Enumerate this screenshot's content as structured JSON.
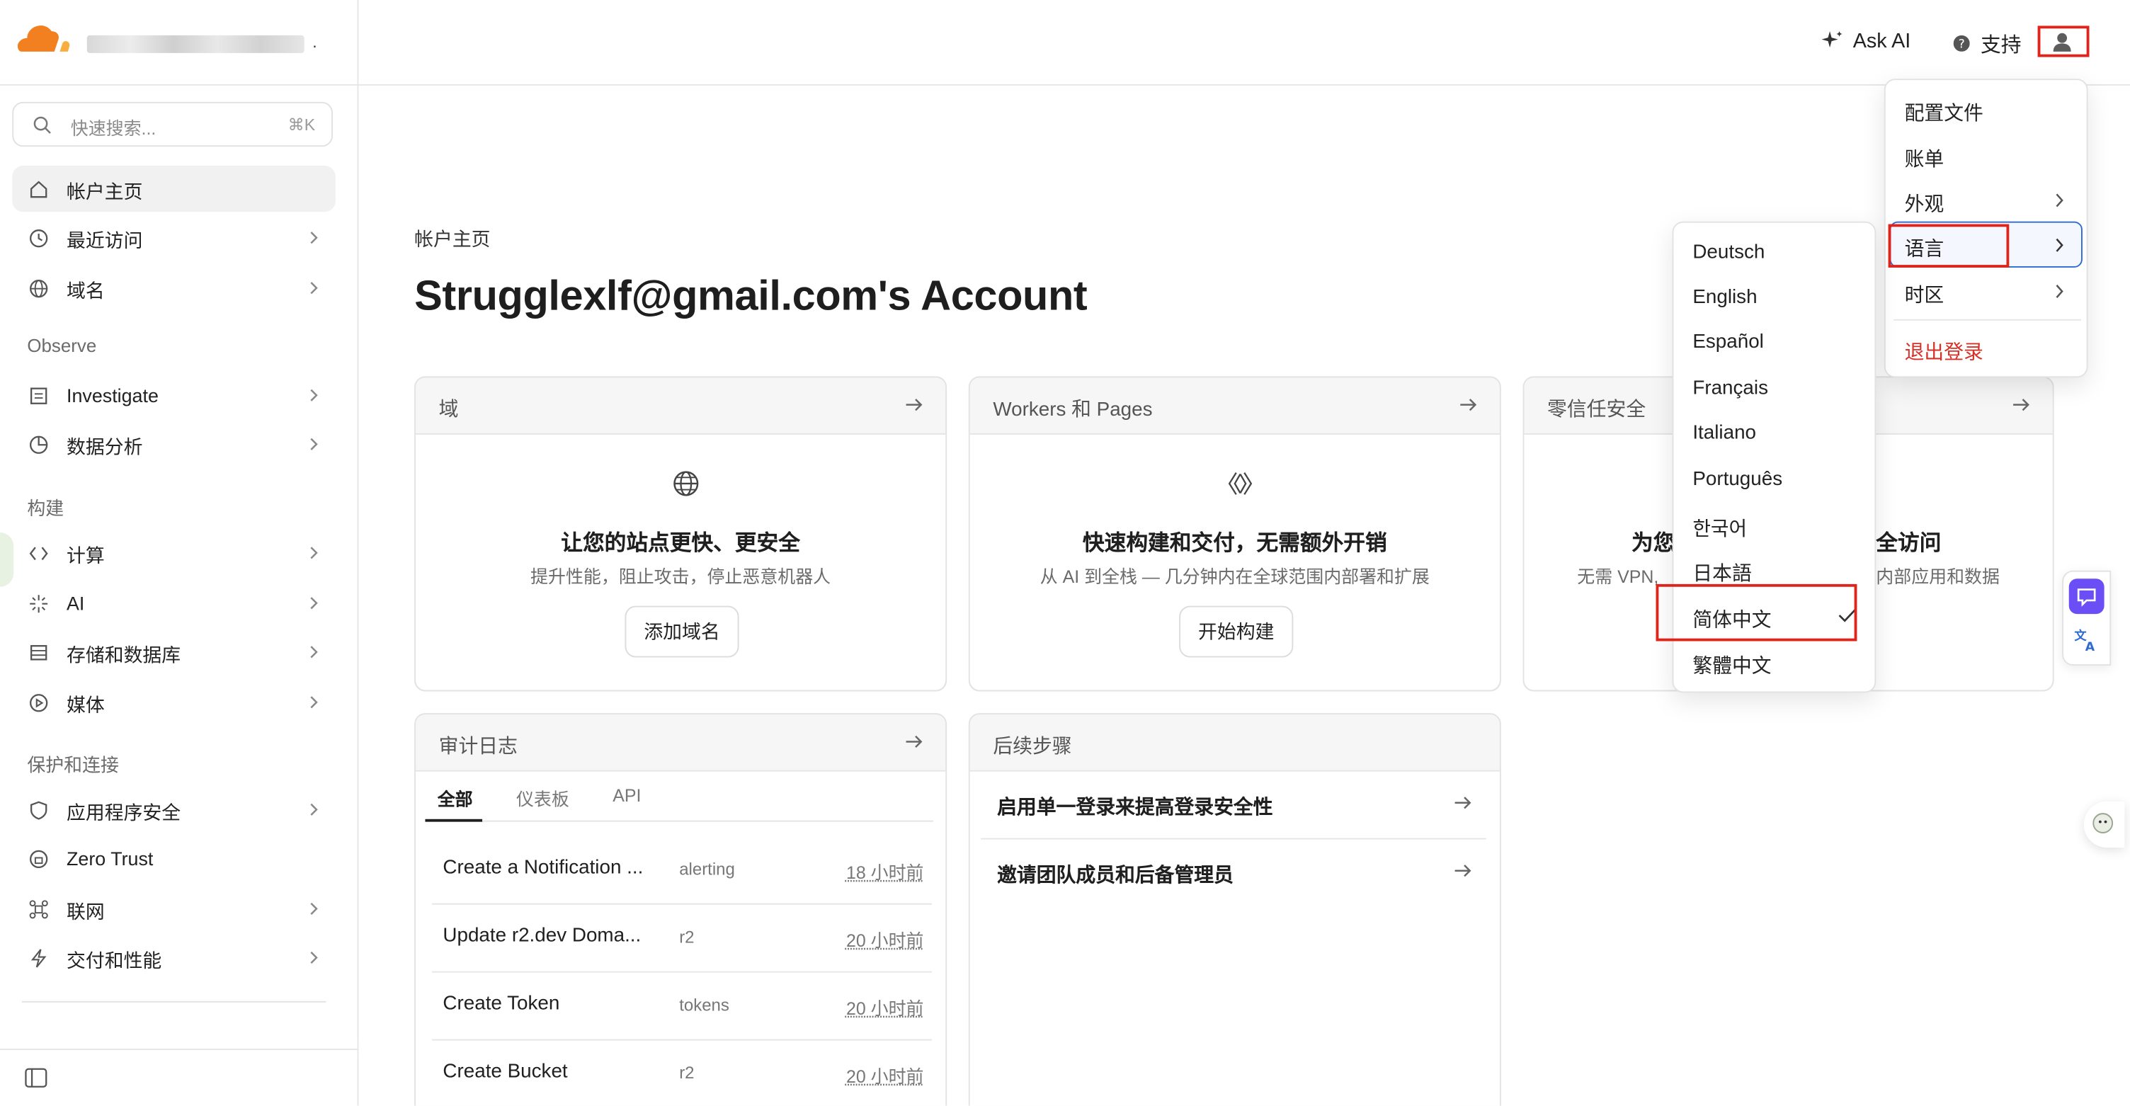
{
  "colors": {
    "accent": "#f38020",
    "danger": "#d63027",
    "highlight": "#e0241b",
    "selection_blue": "#2d6bd4"
  },
  "header": {
    "ask_ai": "Ask AI",
    "support": "支持"
  },
  "search": {
    "placeholder": "快速搜索...",
    "shortcut": "⌘K"
  },
  "sidebar": {
    "home": "帐户主页",
    "recent": "最近访问",
    "domains": "域名",
    "observe": "Observe",
    "investigate": "Investigate",
    "analytics": "数据分析",
    "build": "构建",
    "compute": "计算",
    "ai": "AI",
    "storage": "存储和数据库",
    "media": "媒体",
    "protect": "保护和连接",
    "app_security": "应用程序安全",
    "zero_trust": "Zero Trust",
    "networking": "联网",
    "delivery": "交付和性能"
  },
  "page": {
    "breadcrumb": "帐户主页",
    "title": "Strugglexlf@gmail.com's Account"
  },
  "cards": {
    "domain": {
      "header": "域",
      "title": "让您的站点更快、更安全",
      "subtitle": "提升性能，阻止攻击，停止恶意机器人",
      "button": "添加域名"
    },
    "workers": {
      "header": "Workers 和 Pages",
      "title": "快速构建和交付，无需额外开销",
      "subtitle": "从 AI 到全栈 — 几分钟内在全球范围内部署和扩展",
      "button": "开始构建"
    },
    "zerotrust": {
      "header": "零信任安全",
      "title_left": "为您",
      "title_right": "全访问",
      "sub_left": "无需 VPN,",
      "sub_right": "内部应用和数据"
    }
  },
  "audit": {
    "header": "审计日志",
    "tabs": [
      "全部",
      "仪表板",
      "API"
    ],
    "rows": [
      {
        "action": "Create a Notification ...",
        "service": "alerting",
        "time": "18 小时前"
      },
      {
        "action": "Update r2.dev Doma...",
        "service": "r2",
        "time": "20 小时前"
      },
      {
        "action": "Create Token",
        "service": "tokens",
        "time": "20 小时前"
      },
      {
        "action": "Create Bucket",
        "service": "r2",
        "time": "20 小时前"
      }
    ]
  },
  "next_steps": {
    "header": "后续步骤",
    "items": [
      "启用单一登录来提高登录安全性",
      "邀请团队成员和后备管理员"
    ]
  },
  "profile_menu": {
    "profile": "配置文件",
    "billing": "账单",
    "appearance": "外观",
    "language": "语言",
    "timezone": "时区",
    "logout": "退出登录"
  },
  "language_menu": {
    "items": [
      "Deutsch",
      "English",
      "Español",
      "Français",
      "Italiano",
      "Português",
      "한국어",
      "日本語",
      "简体中文",
      "繁體中文"
    ],
    "selected": "简体中文"
  }
}
